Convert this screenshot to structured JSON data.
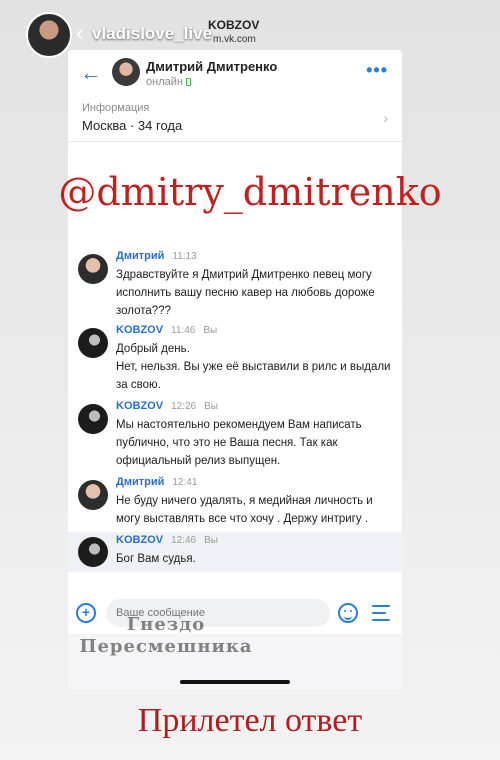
{
  "story": {
    "username": "vladislove_live",
    "phone_title": "KOBZOV",
    "phone_url": "m.vk.com"
  },
  "chat": {
    "contact_name": "Дмитрий Дмитренко",
    "contact_status": "онлайн",
    "info_title": "Информация",
    "info_value": "Москва · 34 года"
  },
  "overlay": {
    "handle": "@dmitry_dmitrenko"
  },
  "messages": [
    {
      "author": "Дмитрий",
      "time": "11:13",
      "you": "",
      "text": "Здравствуйте я Дмитрий Дмитренко певец могу исполнить вашу песню кавер на любовь дороже золота???"
    },
    {
      "author": "KOBZOV",
      "time": "11:46",
      "you": "Вы",
      "text": "Добрый день.\nНет, нельзя. Вы уже её выставили в рилс и выдали за свою."
    },
    {
      "author": "KOBZOV",
      "time": "12:26",
      "you": "Вы",
      "text": "Мы настоятельно рекомендуем Вам написать публично, что это не Ваша песня. Так как официальный релиз выпущен."
    },
    {
      "author": "Дмитрий",
      "time": "12:41",
      "you": "",
      "text": "Не буду ничего удалять, я медийная личность и могу выставлять все что хочу . Держу интригу ."
    },
    {
      "author": "KOBZOV",
      "time": "12:46",
      "you": "Вы",
      "text": "Бог Вам судья."
    }
  ],
  "composer": {
    "placeholder": "Ваше сообщение"
  },
  "watermark": {
    "line1": "Гнездо",
    "line2": "Пересмешника"
  },
  "caption": "Прилетел ответ",
  "colors": {
    "vk_blue": "#2a7ed8",
    "caption_red": "#b11d1d"
  }
}
